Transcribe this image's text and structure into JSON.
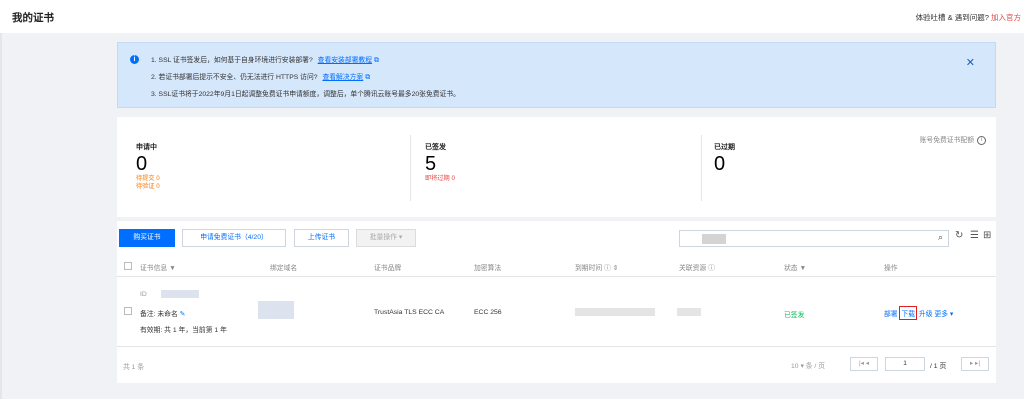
{
  "header": {
    "title": "我的证书",
    "feedback_text": "体验吐槽 & 遇到问题?",
    "join_link": "加入官方"
  },
  "notice": {
    "lines": [
      {
        "text": "1. SSL 证书签发后，如何基于自身环境进行安装部署?",
        "link": "查看安装部署教程"
      },
      {
        "text": "2. 若证书部署后提示不安全、仍无法进行 HTTPS 访问?",
        "link": "查看解决方案"
      },
      {
        "text": "3. SSL证书将于2022年9月1日起调整免费证书申请额度，调整后，单个腾讯云账号最多20张免费证书。",
        "link": ""
      }
    ],
    "close": "✕",
    "info_icon": "i"
  },
  "stats": {
    "quota_label": "账号免费证书配额",
    "applying": {
      "label": "申请中",
      "value": "0",
      "sub1": "待提交 0",
      "sub2": "待验证 0"
    },
    "issued": {
      "label": "已签发",
      "value": "5",
      "sub1": "即将过期 0"
    },
    "expired": {
      "label": "已过期",
      "value": "0"
    }
  },
  "toolbar": {
    "buy_button": "购买证书",
    "apply_free_button": "申请免费证书（4/20）",
    "upload_button": "上传证书",
    "batch_button": "批量操作 ▾"
  },
  "table": {
    "headers": {
      "cert_info": "证书信息",
      "domain": "绑定域名",
      "brand": "证书品牌",
      "algorithm": "加密算法",
      "expire": "到期时间",
      "resource": "关联资源",
      "status": "状态",
      "action": "操作"
    },
    "rows": [
      {
        "id_prefix": "ID",
        "note_label": "备注:",
        "note_value": "未命名",
        "validity_label": "有效期:",
        "validity_value": "共 1 年，当前第 1 年",
        "brand": "TrustAsia TLS ECC CA",
        "algorithm": "ECC 256",
        "status": "已签发",
        "actions": {
          "deploy": "部署",
          "download": "下载",
          "upgrade": "升级",
          "more": "更多 ▾"
        }
      }
    ]
  },
  "footer": {
    "total": "共 1 条",
    "page_size": "10 ▾ 条 / 页",
    "current_page": "1",
    "total_pages": "/ 1 页"
  },
  "colors": {
    "accent": "#006eff",
    "success": "#0abf5b",
    "warning": "#ff7800",
    "danger": "#e54545"
  }
}
